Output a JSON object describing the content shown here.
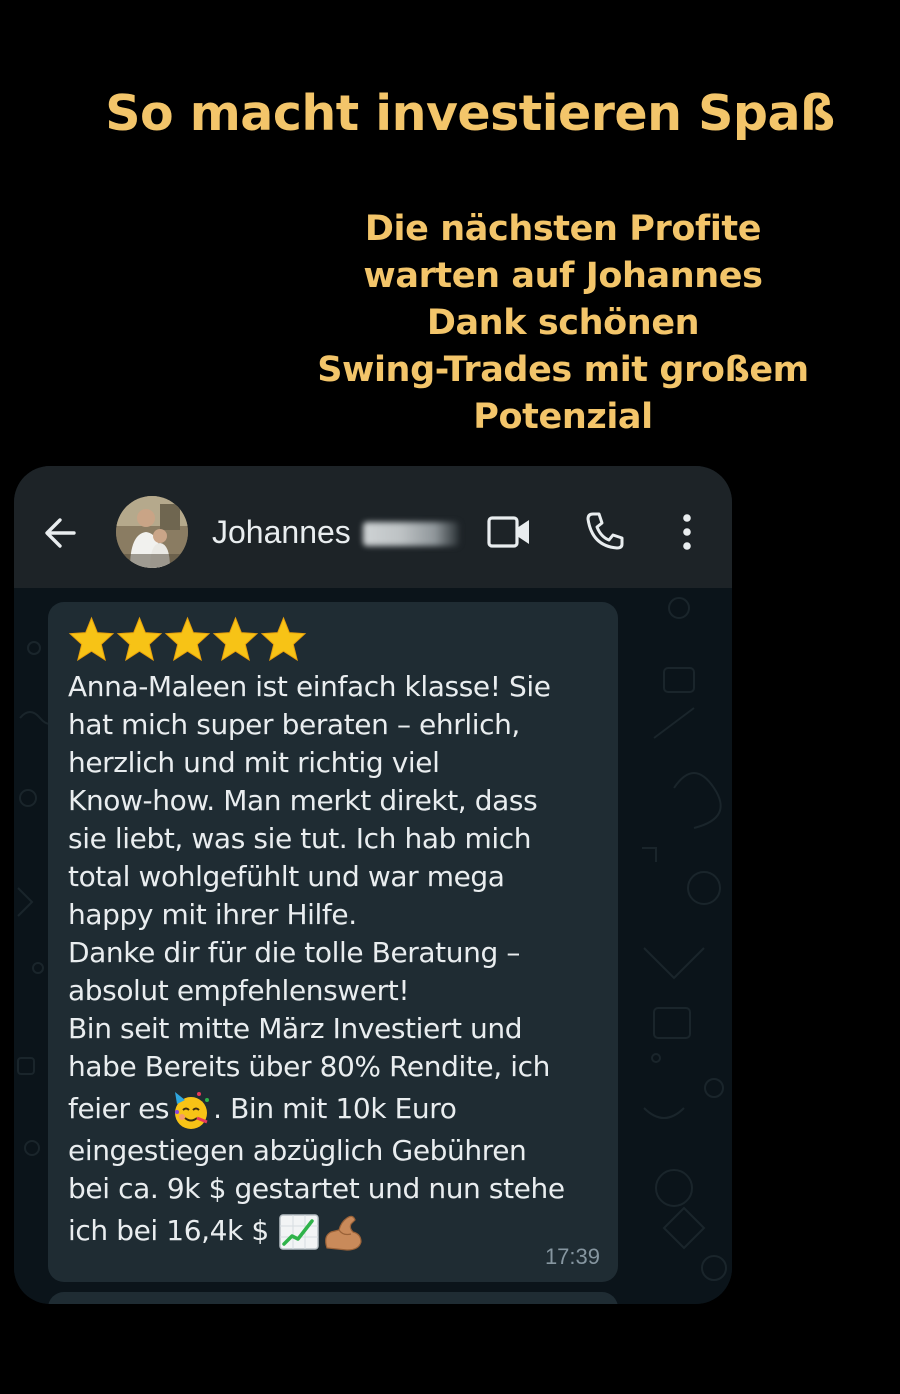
{
  "headline": "So macht investieren Spaß",
  "subline": [
    "Die nächsten Profite",
    "warten auf Johannes",
    "Dank schönen",
    "Swing-Trades mit großem",
    "Potenzial"
  ],
  "colors": {
    "accent": "#f3c56a",
    "page_bg": "#000000",
    "header_bg": "#1d2327",
    "bubble_bg": "#1f2c33",
    "chat_bg": "#0b141a",
    "text": "#e9edef",
    "timestamp": "#8696a0",
    "star": "#f7c316"
  },
  "chat": {
    "contact_name": "Johannes",
    "icons": {
      "back": "arrow-left-icon",
      "video": "video-camera-icon",
      "call": "phone-icon",
      "menu": "three-dots-vertical-icon"
    },
    "message": {
      "rating_stars": 5,
      "lines": [
        "Anna-Maleen ist einfach klasse! Sie",
        "hat mich super beraten – ehrlich,",
        "herzlich und mit richtig viel",
        "Know-how. Man merkt direkt, dass",
        "sie liebt, was sie tut. Ich hab mich",
        "total wohlgefühlt und war mega",
        "happy mit ihrer Hilfe.",
        "Danke dir für die tolle Beratung –",
        "absolut empfehlenswert!",
        "Bin seit mitte März Investiert und",
        "habe Bereits über 80% Rendite, ich"
      ],
      "line_feier_before": "feier es",
      "line_feier_after": ". Bin mit 10k Euro",
      "line_12": "eingestiegen abzüglich Gebühren",
      "line_13": "bei ca. 9k $ gestartet und nun stehe",
      "line_14": "ich bei 16,4k $ ",
      "emojis": [
        "partying-face-icon",
        "chart-increasing-icon",
        "flexed-biceps-icon"
      ],
      "time": "17:39"
    }
  }
}
